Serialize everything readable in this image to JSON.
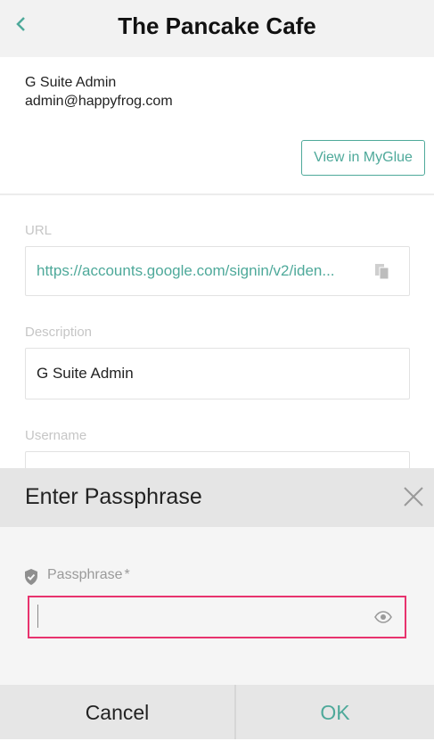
{
  "header": {
    "back_icon": "chevron-left-icon",
    "title": "The Pancake Cafe"
  },
  "account": {
    "name": "G Suite Admin",
    "email": "admin@happyfrog.com"
  },
  "actions": {
    "view_myglue_label": "View in MyGlue"
  },
  "fields": {
    "url": {
      "label": "URL",
      "value": "https://accounts.google.com/signin/v2/iden...",
      "copy_icon": "copy-icon"
    },
    "description": {
      "label": "Description",
      "value": "G Suite Admin"
    },
    "username": {
      "label": "Username"
    }
  },
  "modal": {
    "title": "Enter Passphrase",
    "close_icon": "close-icon",
    "passphrase_label": "Passphrase",
    "required_mark": "*",
    "passphrase_value": "",
    "shield_icon": "shield-check-icon",
    "eye_icon": "eye-icon",
    "cancel_label": "Cancel",
    "ok_label": "OK"
  },
  "colors": {
    "accent": "#4ea99a",
    "focus_border": "#e8336e"
  }
}
